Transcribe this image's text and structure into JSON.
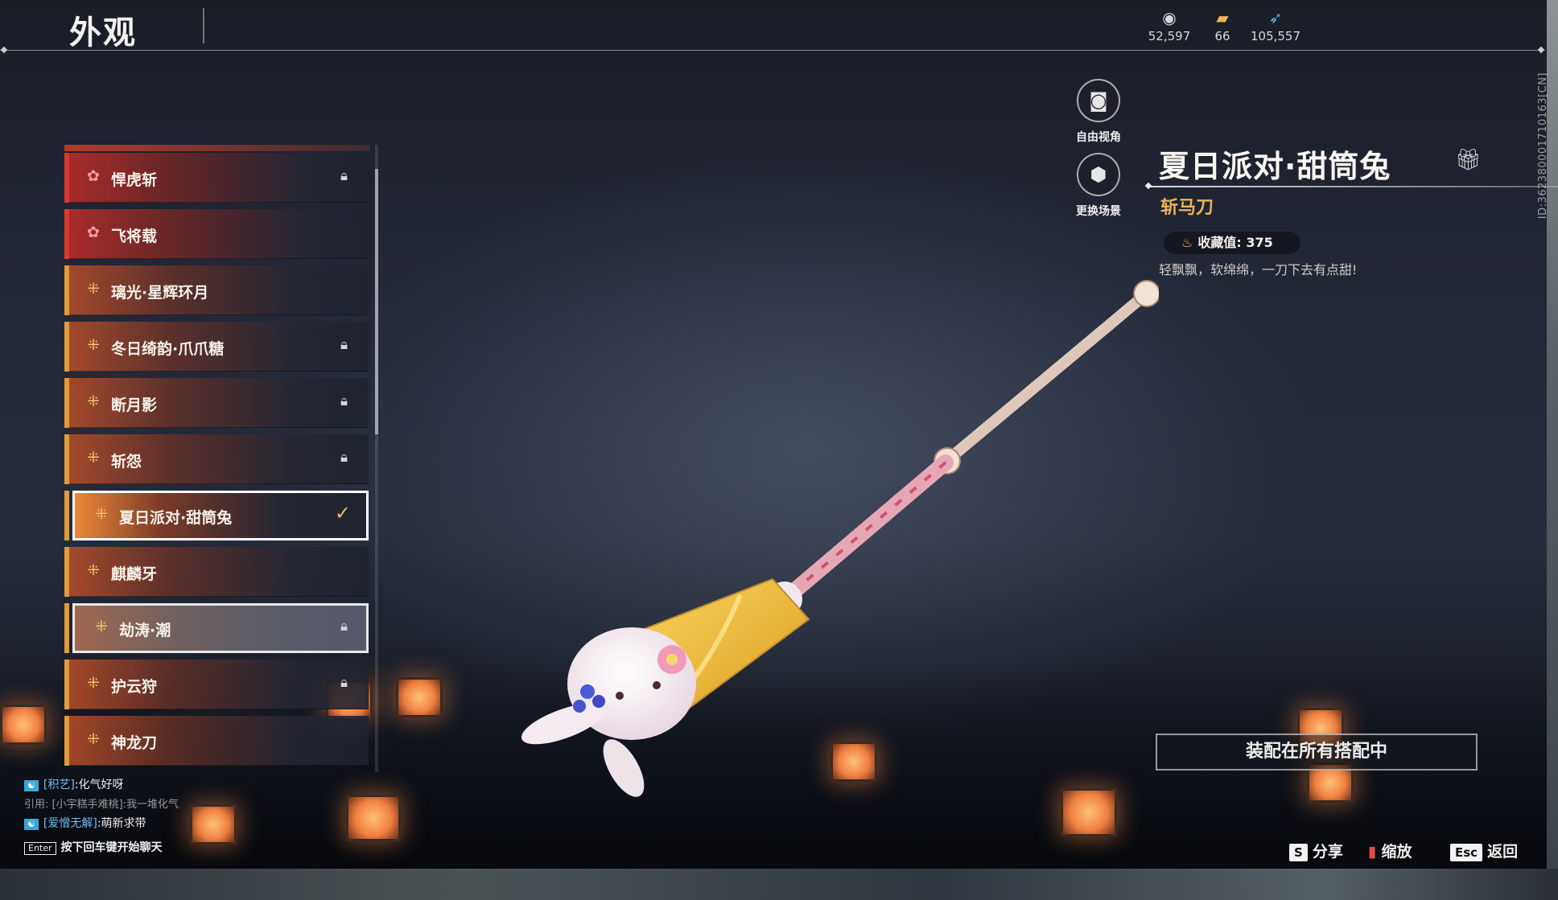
{
  "header": {
    "title": "外观",
    "currencies": [
      {
        "icon": "coin-stack-icon",
        "value": "52,597"
      },
      {
        "icon": "ticket-icon",
        "value": "66"
      },
      {
        "icon": "feather-icon",
        "value": "105,557"
      }
    ]
  },
  "list": {
    "items": [
      {
        "name": "悍虎斩",
        "rarity": "red",
        "locked": true
      },
      {
        "name": "飞将载",
        "rarity": "red",
        "locked": false
      },
      {
        "name": "璃光·星辉环月",
        "rarity": "gold",
        "locked": false
      },
      {
        "name": "冬日绮韵·爪爪糖",
        "rarity": "gold",
        "locked": true
      },
      {
        "name": "断月影",
        "rarity": "gold",
        "locked": true
      },
      {
        "name": "斩怨",
        "rarity": "gold",
        "locked": true
      },
      {
        "name": "夏日派对·甜筒兔",
        "rarity": "gold",
        "selected": true,
        "equipped": true
      },
      {
        "name": "麒麟牙",
        "rarity": "gold",
        "locked": false
      },
      {
        "name": "劫涛·潮",
        "rarity": "gold",
        "locked": true,
        "hovered": true
      },
      {
        "name": "护云狩",
        "rarity": "gold",
        "locked": true
      },
      {
        "name": "神龙刀",
        "rarity": "gold",
        "locked": false
      }
    ]
  },
  "view_buttons": {
    "free_view": "自由视角",
    "change_scene": "更换场景"
  },
  "detail": {
    "title": "夏日派对·甜筒兔",
    "type": "斩马刀",
    "collection_label": "收藏值:",
    "collection_value": "375",
    "description": "轻飘飘，软绵绵，一刀下去有点甜!",
    "id_text": "ID:362380001710163[CN]",
    "equip_all_button": "装配在所有搭配中"
  },
  "chat": {
    "line1_channel": "[积艺]",
    "line1_text": ":化气好呀",
    "quote": "引用: [小宇糕手难桃]:我一堆化气",
    "line2_channel": "[爱憎无解]",
    "line2_text": ":萌新求带",
    "enter_key": "Enter",
    "enter_hint": "按下回车键开始聊天"
  },
  "bottom_keys": {
    "share_key": "S",
    "share_label": "分享",
    "zoom_label": "缩放",
    "back_key": "Esc",
    "back_label": "返回"
  },
  "colors": {
    "gold_accent": "#e19b3a",
    "red_accent": "#d63b2f",
    "weapon_type": "#e9b45a"
  }
}
